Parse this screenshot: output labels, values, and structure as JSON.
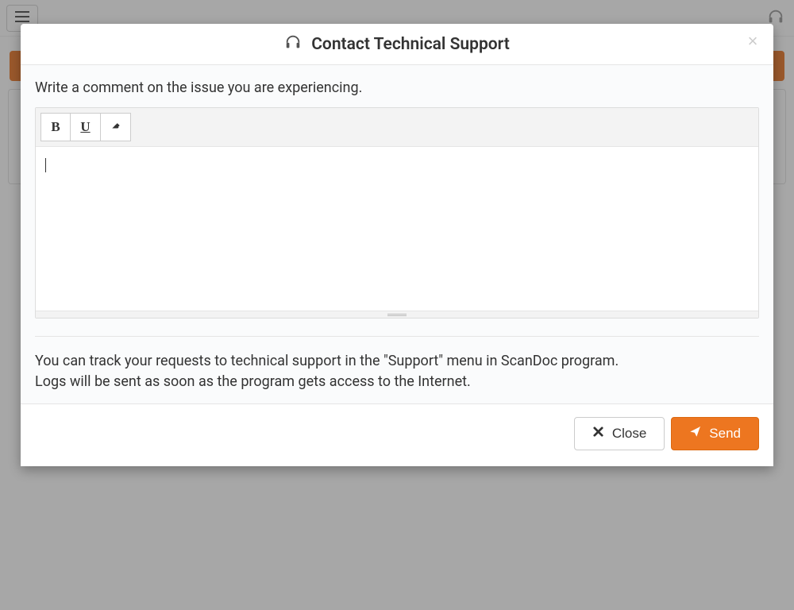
{
  "modal": {
    "title": "Contact Technical Support",
    "prompt": "Write a comment on the issue you are experiencing.",
    "info_line1": "You can track your requests to technical support in the \"Support\" menu in ScanDoc program.",
    "info_line2": "Logs will be sent as soon as the program gets access to the Internet.",
    "close_label": "Close",
    "send_label": "Send"
  },
  "toolbar": {
    "bold_label": "B",
    "underline_label": "U"
  }
}
